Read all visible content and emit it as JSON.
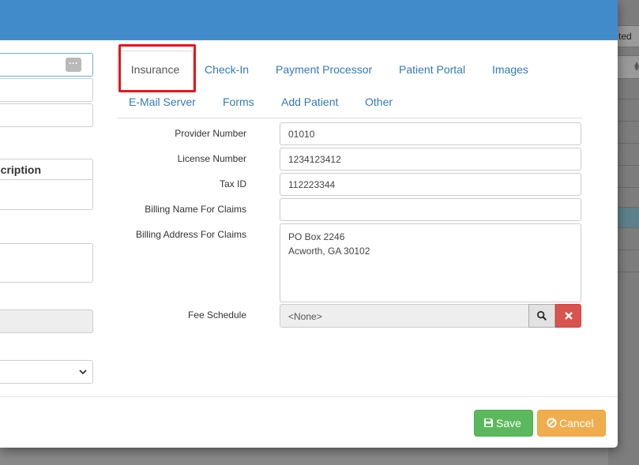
{
  "background": {
    "button_label": "ted"
  },
  "left_column": {
    "table_header": "Description"
  },
  "tabs": [
    {
      "label": "Insurance"
    },
    {
      "label": "Check-In"
    },
    {
      "label": "Payment Processor"
    },
    {
      "label": "Patient Portal"
    },
    {
      "label": "Images"
    },
    {
      "label": "E-Mail Server"
    },
    {
      "label": "Forms"
    },
    {
      "label": "Add Patient"
    },
    {
      "label": "Other"
    }
  ],
  "form": {
    "provider_number": {
      "label": "Provider Number",
      "value": "01010"
    },
    "license_number": {
      "label": "License Number",
      "value": "1234123412"
    },
    "tax_id": {
      "label": "Tax ID",
      "value": "112223344"
    },
    "billing_name": {
      "label": "Billing Name For Claims",
      "value": ""
    },
    "billing_address": {
      "label": "Billing Address For Claims",
      "line1": "PO Box 2246",
      "line2": "Acworth, GA 30102"
    },
    "fee_schedule": {
      "label": "Fee Schedule",
      "value": "<None>"
    }
  },
  "footer": {
    "save_label": "Save",
    "cancel_label": "Cancel"
  },
  "colors": {
    "header_blue": "#428bca",
    "link_blue": "#337ab7",
    "save_green": "#5cb85c",
    "cancel_orange": "#f0ad4e",
    "clear_red": "#d9534f",
    "highlight_red": "#e8141c"
  }
}
